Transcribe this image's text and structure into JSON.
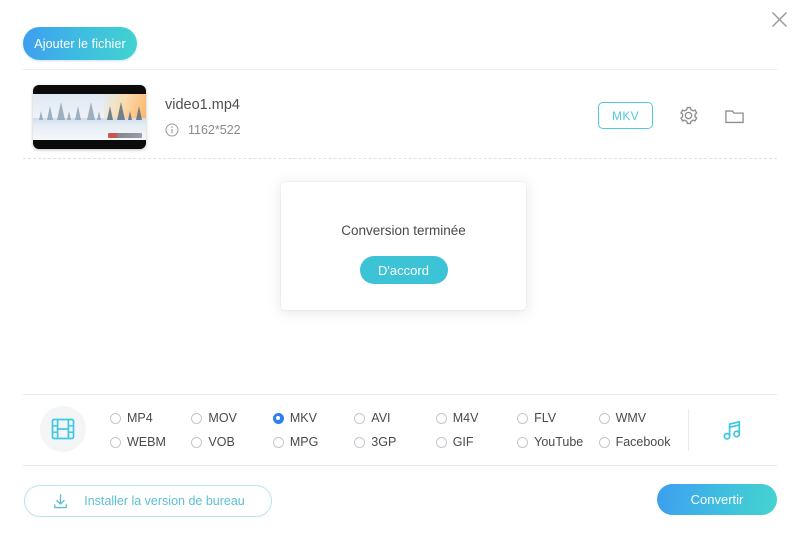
{
  "window": {
    "close_icon": "close-icon"
  },
  "toolbar": {
    "add_file_label": "Ajouter le fichier"
  },
  "file": {
    "name": "video1.mp4",
    "resolution": "1162*522",
    "info_icon": "info-icon",
    "target_format": "MKV",
    "settings_icon": "gear-icon",
    "folder_icon": "folder-icon",
    "thumbnail_alt": "winter-landscape-thumbnail"
  },
  "dialog": {
    "message": "Conversion terminée",
    "ok_label": "D'accord"
  },
  "formats": {
    "video_icon": "film-strip-icon",
    "audio_icon": "music-note-icon",
    "selected": "MKV",
    "options": [
      {
        "label": "MP4",
        "selected": false
      },
      {
        "label": "WEBM",
        "selected": false
      },
      {
        "label": "MOV",
        "selected": false
      },
      {
        "label": "VOB",
        "selected": false
      },
      {
        "label": "MKV",
        "selected": true
      },
      {
        "label": "MPG",
        "selected": false
      },
      {
        "label": "AVI",
        "selected": false
      },
      {
        "label": "3GP",
        "selected": false
      },
      {
        "label": "M4V",
        "selected": false
      },
      {
        "label": "GIF",
        "selected": false
      },
      {
        "label": "FLV",
        "selected": false
      },
      {
        "label": "YouTube",
        "selected": false
      },
      {
        "label": "WMV",
        "selected": false
      },
      {
        "label": "Facebook",
        "selected": false
      }
    ]
  },
  "footer": {
    "install_label": "Installer la version de bureau",
    "install_icon": "download-icon",
    "convert_label": "Convertir"
  },
  "colors": {
    "accent_gradient_start": "#3d9ef0",
    "accent_gradient_end": "#44d4cd",
    "teal": "#3cc3d6",
    "radio_selected": "#2f80ed",
    "icon_cyan": "#4fc9dd"
  }
}
